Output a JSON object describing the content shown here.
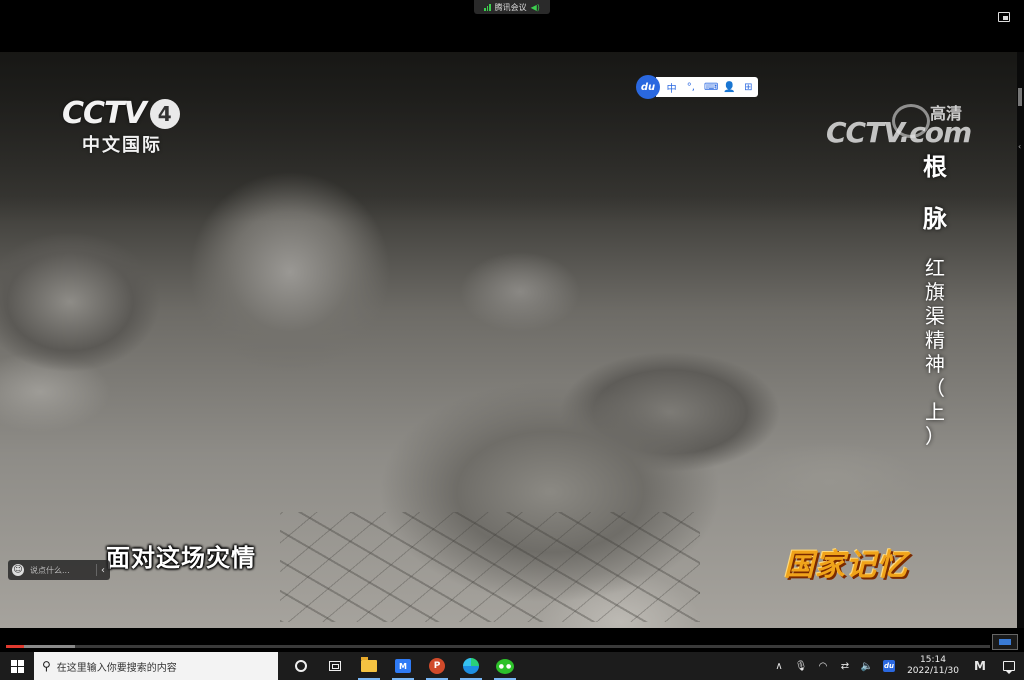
{
  "meeting": {
    "app_name": "腾讯会议"
  },
  "video": {
    "channel_logo_text": "CCTV",
    "channel_number": "4",
    "channel_subtitle": "中文国际",
    "watermark_text": "CCTV.com",
    "watermark_quality": "高清",
    "subtitle": "面对这场灾情",
    "program_logo": "国家记忆",
    "vertical_title": {
      "line1": [
        "根",
        "脉"
      ],
      "line2": [
        "红",
        "旗",
        "渠",
        "精",
        "神",
        "（",
        "上",
        "）"
      ]
    },
    "progress_fraction": 0.018,
    "buffer_fraction": 0.07
  },
  "baidu_toolbar": {
    "logo": "du",
    "items": [
      "中",
      "°,",
      "⌨",
      "👤",
      "⊞"
    ]
  },
  "comment_box": {
    "placeholder": "说点什么..."
  },
  "taskbar": {
    "search_placeholder": "在这里输入你要搜索的内容",
    "meeting_icon_label": "M",
    "ppt_icon_label": "P",
    "tray": {
      "up_arrow": "∧",
      "clock_time": "15:14",
      "clock_date": "2022/11/30",
      "input_method": "M",
      "baidu": "du"
    }
  },
  "colors": {
    "accent_blue": "#2a68e0",
    "progress_red": "#e03a2f",
    "program_logo_gold": "#f0a31a",
    "signal_green": "#3ccf4e"
  }
}
